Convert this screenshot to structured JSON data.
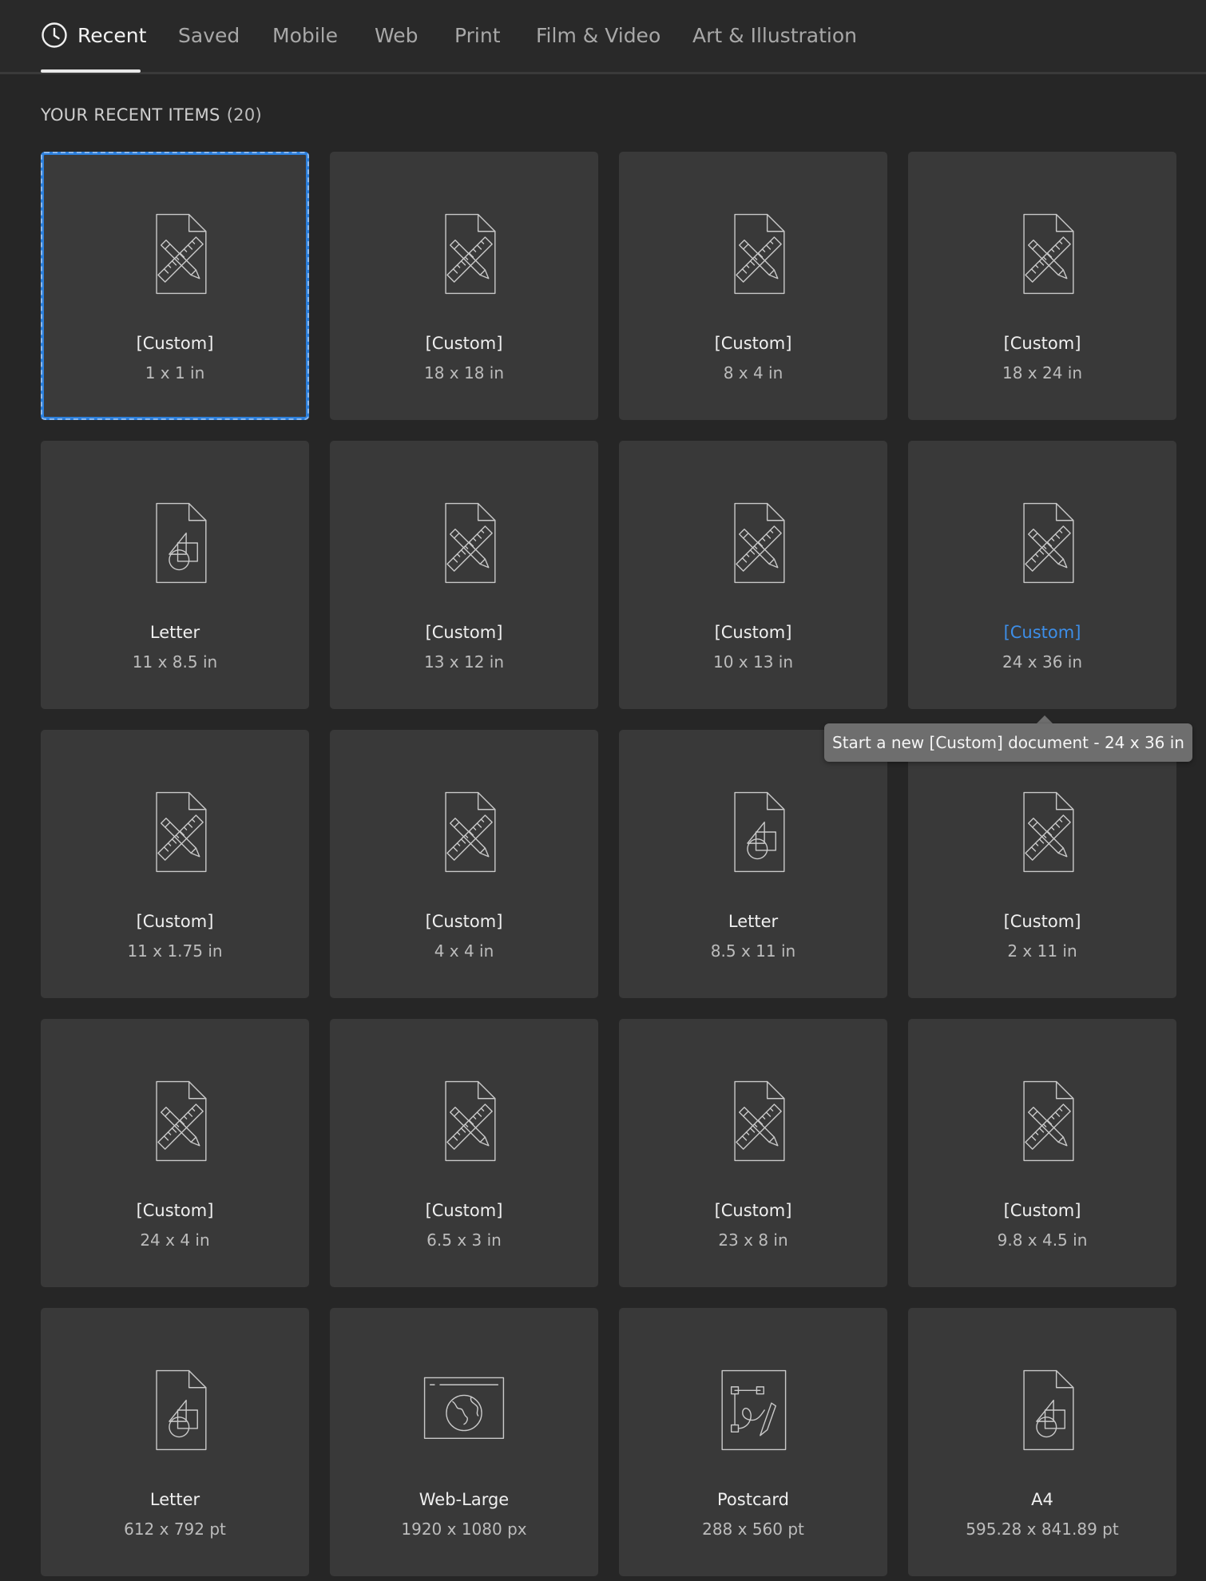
{
  "tabs": [
    {
      "label": "Recent",
      "icon": "clock-icon",
      "active": true
    },
    {
      "label": "Saved"
    },
    {
      "label": "Mobile"
    },
    {
      "label": "Web"
    },
    {
      "label": "Print"
    },
    {
      "label": "Film & Video"
    },
    {
      "label": "Art & Illustration"
    }
  ],
  "section": {
    "title": "YOUR RECENT ITEMS",
    "count": "(20)"
  },
  "items": [
    {
      "name": "[Custom]",
      "size": "1 x 1 in",
      "icon": "custom-document-icon",
      "selected": true
    },
    {
      "name": "[Custom]",
      "size": "18 x 18 in",
      "icon": "custom-document-icon"
    },
    {
      "name": "[Custom]",
      "size": "8 x 4 in",
      "icon": "custom-document-icon"
    },
    {
      "name": "[Custom]",
      "size": "18 x 24 in",
      "icon": "custom-document-icon"
    },
    {
      "name": "Letter",
      "size": "11 x 8.5 in",
      "icon": "shapes-document-icon"
    },
    {
      "name": "[Custom]",
      "size": "13 x 12 in",
      "icon": "custom-document-icon"
    },
    {
      "name": "[Custom]",
      "size": "10 x 13 in",
      "icon": "custom-document-icon"
    },
    {
      "name": "[Custom]",
      "size": "24 x 36 in",
      "icon": "custom-document-icon",
      "hovered": true
    },
    {
      "name": "[Custom]",
      "size": "11 x 1.75 in",
      "icon": "custom-document-icon"
    },
    {
      "name": "[Custom]",
      "size": "4 x 4 in",
      "icon": "custom-document-icon"
    },
    {
      "name": "Letter",
      "size": "8.5 x 11 in",
      "icon": "shapes-document-icon"
    },
    {
      "name": "[Custom]",
      "size": "2 x 11 in",
      "icon": "custom-document-icon"
    },
    {
      "name": "[Custom]",
      "size": "24 x 4 in",
      "icon": "custom-document-icon"
    },
    {
      "name": "[Custom]",
      "size": "6.5 x 3 in",
      "icon": "custom-document-icon"
    },
    {
      "name": "[Custom]",
      "size": "23 x 8 in",
      "icon": "custom-document-icon"
    },
    {
      "name": "[Custom]",
      "size": "9.8 x 4.5 in",
      "icon": "custom-document-icon"
    },
    {
      "name": "Letter",
      "size": "612 x 792 pt",
      "icon": "shapes-document-icon"
    },
    {
      "name": "Web-Large",
      "size": "1920 x 1080 px",
      "icon": "web-globe-icon"
    },
    {
      "name": "Postcard",
      "size": "288 x 560 pt",
      "icon": "postcard-icon"
    },
    {
      "name": "A4",
      "size": "595.28 x 841.89 pt",
      "icon": "shapes-document-icon"
    }
  ],
  "tooltip": {
    "text": "Start a new [Custom] document - 24 x 36 in"
  },
  "colors": {
    "background": "#262626",
    "card": "#393939",
    "selection": "#2c7fdb",
    "hover_text": "#3d8ee8",
    "tooltip": "#6e6e6e"
  }
}
